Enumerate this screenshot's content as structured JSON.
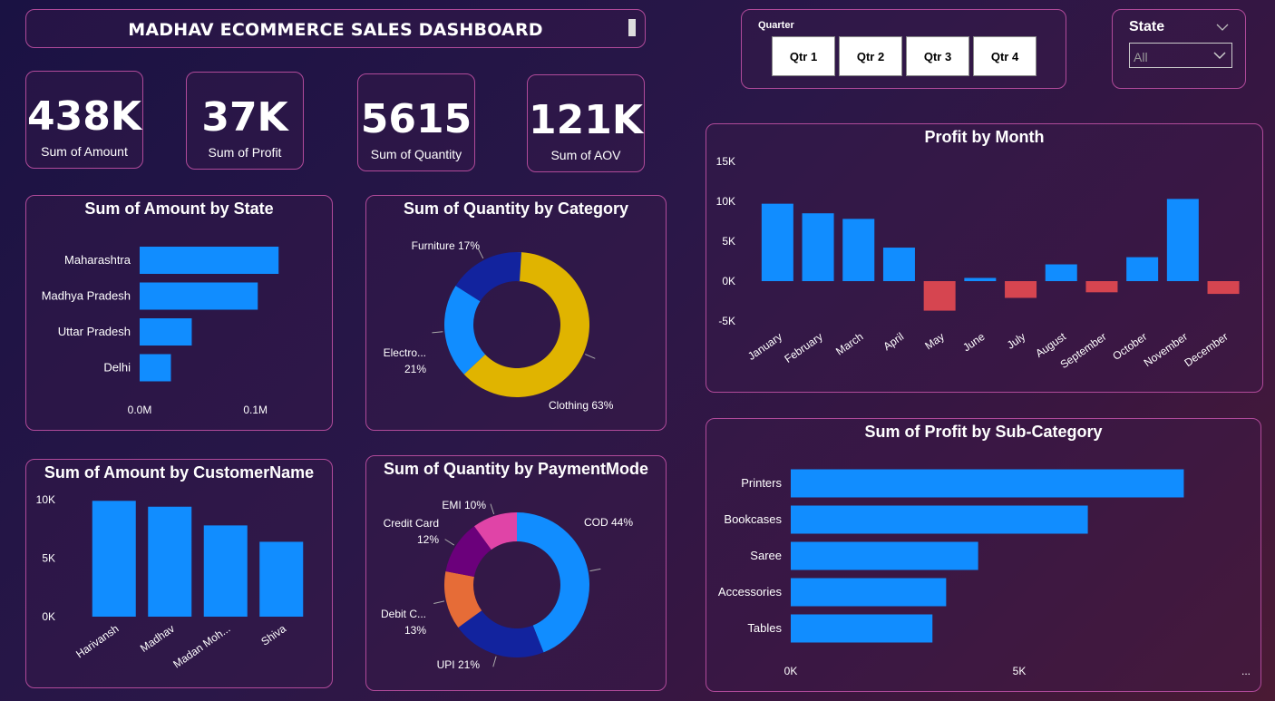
{
  "header": {
    "title": "MADHAV ECOMMERCE SALES DASHBOARD"
  },
  "kpis": [
    {
      "value": "438K",
      "label": "Sum of Amount"
    },
    {
      "value": "37K",
      "label": "Sum of Profit"
    },
    {
      "value": "5615",
      "label": "Sum of Quantity"
    },
    {
      "value": "121K",
      "label": "Sum of AOV"
    }
  ],
  "quarter_slicer": {
    "label": "Quarter",
    "options": [
      "Qtr 1",
      "Qtr 2",
      "Qtr 3",
      "Qtr 4"
    ]
  },
  "state_slicer": {
    "label": "State",
    "selected": "All"
  },
  "colors": {
    "blue": "#118dff",
    "red": "#d64550",
    "yellow": "#e0b400",
    "navy": "#12239e",
    "orange": "#e66c37",
    "purple": "#6b007b",
    "pink": "#e044a7",
    "border": "#b04a9a"
  },
  "chart_data": [
    {
      "id": "amount_by_state",
      "type": "bar",
      "orientation": "horizontal",
      "title": "Sum of Amount by State",
      "categories": [
        "Maharashtra",
        "Madhya Pradesh",
        "Uttar Pradesh",
        "Delhi"
      ],
      "values": [
        0.12,
        0.102,
        0.045,
        0.027
      ],
      "ticks": [
        "0.0M",
        "0.1M"
      ],
      "xlim": [
        0,
        0.13
      ],
      "unit": "M"
    },
    {
      "id": "quantity_by_category",
      "type": "pie",
      "donut": true,
      "title": "Sum of Quantity by Category",
      "slices": [
        {
          "name": "Clothing",
          "label": "Clothing 63%",
          "percent": 63,
          "color": "#e0b400"
        },
        {
          "name": "Electronics",
          "label_line1": "Electro...",
          "label_line2": "21%",
          "percent": 21,
          "color": "#118dff"
        },
        {
          "name": "Furniture",
          "label": "Furniture 17%",
          "percent": 17,
          "color": "#12239e"
        }
      ]
    },
    {
      "id": "profit_by_month",
      "type": "bar",
      "title": "Profit by Month",
      "categories": [
        "January",
        "February",
        "March",
        "April",
        "May",
        "June",
        "July",
        "August",
        "September",
        "October",
        "November",
        "December"
      ],
      "values": [
        9700,
        8500,
        7800,
        4200,
        -3700,
        400,
        -2100,
        2100,
        -1400,
        3000,
        10300,
        -1600
      ],
      "yticks": [
        "15K",
        "10K",
        "5K",
        "0K",
        "-5K"
      ],
      "ytick_values": [
        15000,
        10000,
        5000,
        0,
        -5000
      ],
      "ylim": [
        -5000,
        15000
      ]
    },
    {
      "id": "amount_by_customer",
      "type": "bar",
      "title": "Sum of Amount by CustomerName",
      "categories": [
        "Harivansh",
        "Madhav",
        "Madan Moh...",
        "Shiva"
      ],
      "values": [
        9900,
        9400,
        7800,
        6400
      ],
      "yticks": [
        "10K",
        "5K",
        "0K"
      ],
      "ytick_values": [
        10000,
        5000,
        0
      ],
      "ylim": [
        0,
        10000
      ]
    },
    {
      "id": "quantity_by_payment",
      "type": "pie",
      "donut": true,
      "title": "Sum of Quantity by PaymentMode",
      "slices": [
        {
          "name": "COD",
          "label": "COD 44%",
          "percent": 44,
          "color": "#118dff"
        },
        {
          "name": "UPI",
          "label": "UPI 21%",
          "percent": 21,
          "color": "#12239e"
        },
        {
          "name": "Debit Card",
          "label_line1": "Debit C...",
          "label_line2": "13%",
          "percent": 13,
          "color": "#e66c37"
        },
        {
          "name": "Credit Card",
          "label_line1": "Credit Card",
          "label_line2": "12%",
          "percent": 12,
          "color": "#6b007b"
        },
        {
          "name": "EMI",
          "label": "EMI 10%",
          "percent": 10,
          "color": "#e044a7"
        }
      ]
    },
    {
      "id": "profit_by_subcategory",
      "type": "bar",
      "orientation": "horizontal",
      "title": "Sum of Profit by Sub-Category",
      "categories": [
        "Printers",
        "Bookcases",
        "Saree",
        "Accessories",
        "Tables"
      ],
      "values": [
        8600,
        6500,
        4100,
        3400,
        3100
      ],
      "ticks": [
        "0K",
        "5K"
      ],
      "xlim": [
        0,
        10000
      ],
      "more": "..."
    }
  ]
}
